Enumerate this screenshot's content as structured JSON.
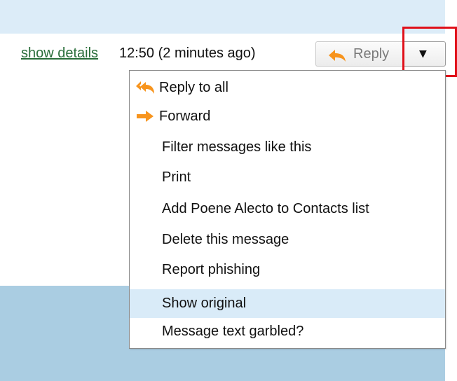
{
  "message_header": {
    "show_details_label": "show details",
    "timestamp": "12:50 (2 minutes ago)",
    "reply_label": "Reply",
    "more_caret": "▼"
  },
  "menu": {
    "items": [
      {
        "label": "Reply to all",
        "icon": "reply-all-icon"
      },
      {
        "label": "Forward",
        "icon": "forward-arrow-icon"
      },
      {
        "label": "Filter messages like this"
      },
      {
        "label": "Print"
      },
      {
        "label": "Add Poene Alecto to Contacts list"
      },
      {
        "label": "Delete this message"
      },
      {
        "label": "Report phishing"
      },
      {
        "label": "Show original",
        "highlighted": true
      },
      {
        "label": "Message text garbled?"
      }
    ]
  },
  "colors": {
    "icon_orange": "#f7941d",
    "link_green": "#2a6e3a",
    "highlight_red": "#e0101a",
    "menu_hover": "#d9ebf8"
  }
}
